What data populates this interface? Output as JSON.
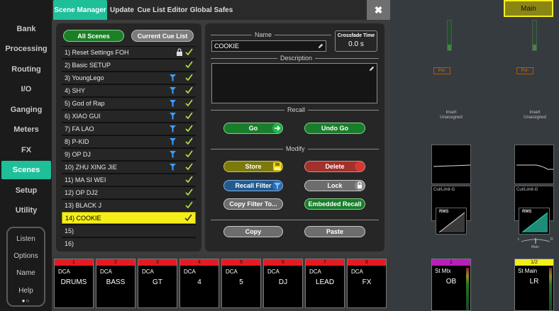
{
  "nav": {
    "items": [
      "Bank",
      "Processing",
      "Routing",
      "I/O",
      "Ganging",
      "Meters",
      "FX",
      "Scenes",
      "Setup",
      "Utility"
    ],
    "active": "Scenes",
    "bottom": [
      "Listen",
      "Options",
      "Name",
      "Help"
    ],
    "page_dots": "●○"
  },
  "tabs": {
    "items": [
      "Scene Manager",
      "Update",
      "Cue List Editor",
      "Global Safes"
    ],
    "active": "Scene Manager",
    "close": "✖"
  },
  "list": {
    "all_scenes_label": "All Scenes",
    "current_cue_label": "Current Cue List",
    "scenes": [
      {
        "label": "1) Reset Settings FOH",
        "lock": true,
        "filter": false,
        "check": true
      },
      {
        "label": "2) Basic SETUP",
        "lock": false,
        "filter": false,
        "check": true
      },
      {
        "label": "3) YoungLego",
        "lock": false,
        "filter": true,
        "check": true
      },
      {
        "label": "4) SHY",
        "lock": false,
        "filter": true,
        "check": true
      },
      {
        "label": "5) God of Rap",
        "lock": false,
        "filter": true,
        "check": true
      },
      {
        "label": "6) XIAO GUI",
        "lock": false,
        "filter": true,
        "check": true
      },
      {
        "label": "7) FA LAO",
        "lock": false,
        "filter": true,
        "check": true
      },
      {
        "label": "8) P-KID",
        "lock": false,
        "filter": true,
        "check": true
      },
      {
        "label": "9) OP DJ",
        "lock": false,
        "filter": true,
        "check": true
      },
      {
        "label": "10) ZHU XING JIE",
        "lock": false,
        "filter": true,
        "check": true
      },
      {
        "label": "11) MA SI WEI",
        "lock": false,
        "filter": false,
        "check": true
      },
      {
        "label": "12) OP DJ2",
        "lock": false,
        "filter": false,
        "check": true
      },
      {
        "label": "13) BLACK J",
        "lock": false,
        "filter": false,
        "check": true
      },
      {
        "label": "14) COOKIE",
        "lock": false,
        "filter": false,
        "check": true,
        "selected": true
      },
      {
        "label": "15)",
        "lock": false,
        "filter": false,
        "check": false
      },
      {
        "label": "16)",
        "lock": false,
        "filter": false,
        "check": false
      }
    ]
  },
  "detail": {
    "name_label": "Name",
    "name_value": "COOKIE",
    "crossfade_label": "Crossfade Time",
    "crossfade_value": "0.0 s",
    "description_label": "Description",
    "description_value": "",
    "recall_label": "Recall",
    "go_label": "Go",
    "undo_go_label": "Undo Go",
    "modify_label": "Modify",
    "store_label": "Store",
    "delete_label": "Delete",
    "recall_filter_label": "Recall Filter",
    "lock_label": "Lock",
    "copy_filter_label": "Copy Filter To...",
    "embedded_recall_label": "Embedded Recall",
    "copy_label": "Copy",
    "paste_label": "Paste"
  },
  "dca": [
    {
      "num": "1",
      "type": "DCA",
      "name": "DRUMS"
    },
    {
      "num": "2",
      "type": "DCA",
      "name": "BASS"
    },
    {
      "num": "3",
      "type": "DCA",
      "name": "GT"
    },
    {
      "num": "4",
      "type": "DCA",
      "name": "4"
    },
    {
      "num": "5",
      "type": "DCA",
      "name": "5"
    },
    {
      "num": "6",
      "type": "DCA",
      "name": "DJ"
    },
    {
      "num": "7",
      "type": "DCA",
      "name": "LEAD"
    },
    {
      "num": "8",
      "type": "DCA",
      "name": "FX"
    }
  ],
  "mixer": {
    "main_button": "Main",
    "strips": [
      {
        "pol": "Pol-",
        "insert": "Insert",
        "insert_state": "Unassigned",
        "comp": "Cut/Limit-G",
        "rms": "RMS",
        "bus_num": "1",
        "bus_type": "St Mtx",
        "bus_name": "OB",
        "bus_color": "#b91eb9"
      },
      {
        "pol": "Pol-",
        "insert": "Insert",
        "insert_state": "Unassigned",
        "comp": "Cut/Limit-G",
        "rms": "RMS",
        "bus_num": "1/2",
        "bus_type": "St Main",
        "bus_name": "LR",
        "bus_color": "#f5ee1a"
      }
    ],
    "pan_left": "L",
    "pan_right": "R",
    "pan_main": "Main"
  },
  "colors": {
    "accent": "#1fbf9a",
    "selected_row": "#f5ee1a",
    "dca_red": "#e51b24",
    "check_green": "#b7e34a",
    "filter_blue": "#3aa0ff"
  }
}
